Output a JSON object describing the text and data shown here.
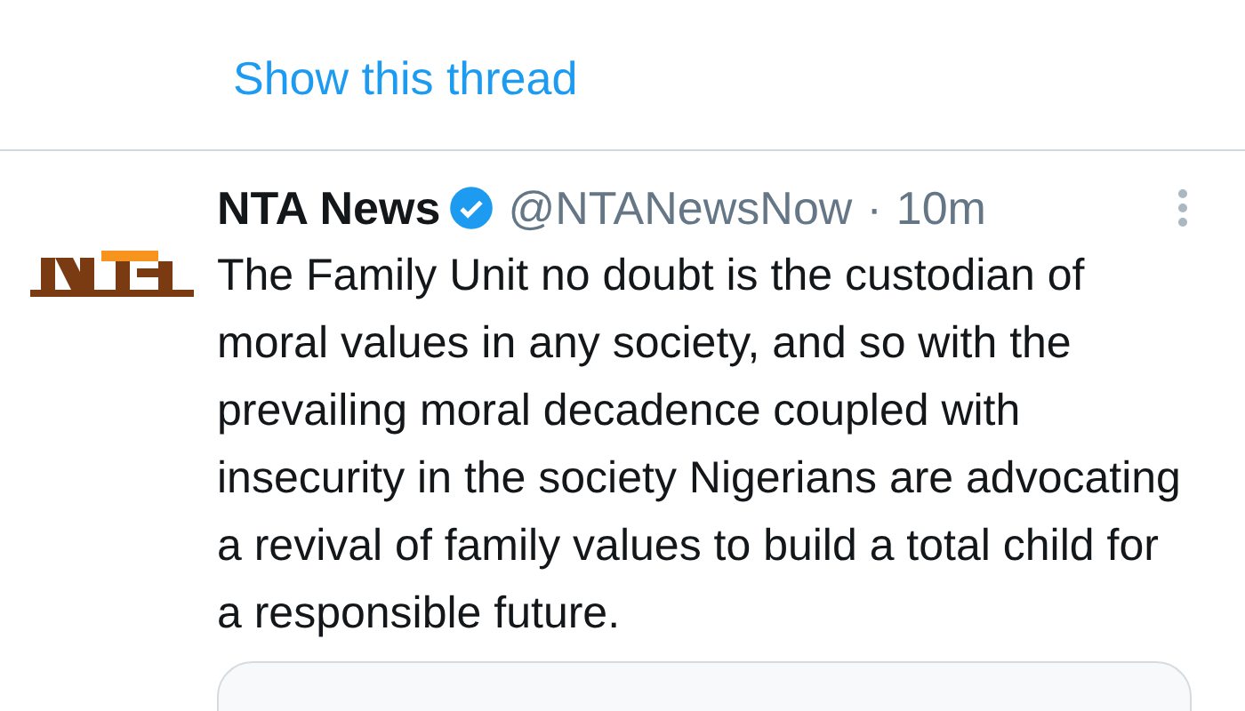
{
  "thread_link": "Show this thread",
  "tweet": {
    "name": "NTA News",
    "verified": true,
    "handle": "@NTANewsNow",
    "separator": "·",
    "time": "10m",
    "text": "The Family Unit no doubt is the custodian of moral values in any society, and so with the prevailing moral decadence coupled with insecurity in the society Nigerians are advocating a revival of family values to build a total child for a responsible future."
  }
}
